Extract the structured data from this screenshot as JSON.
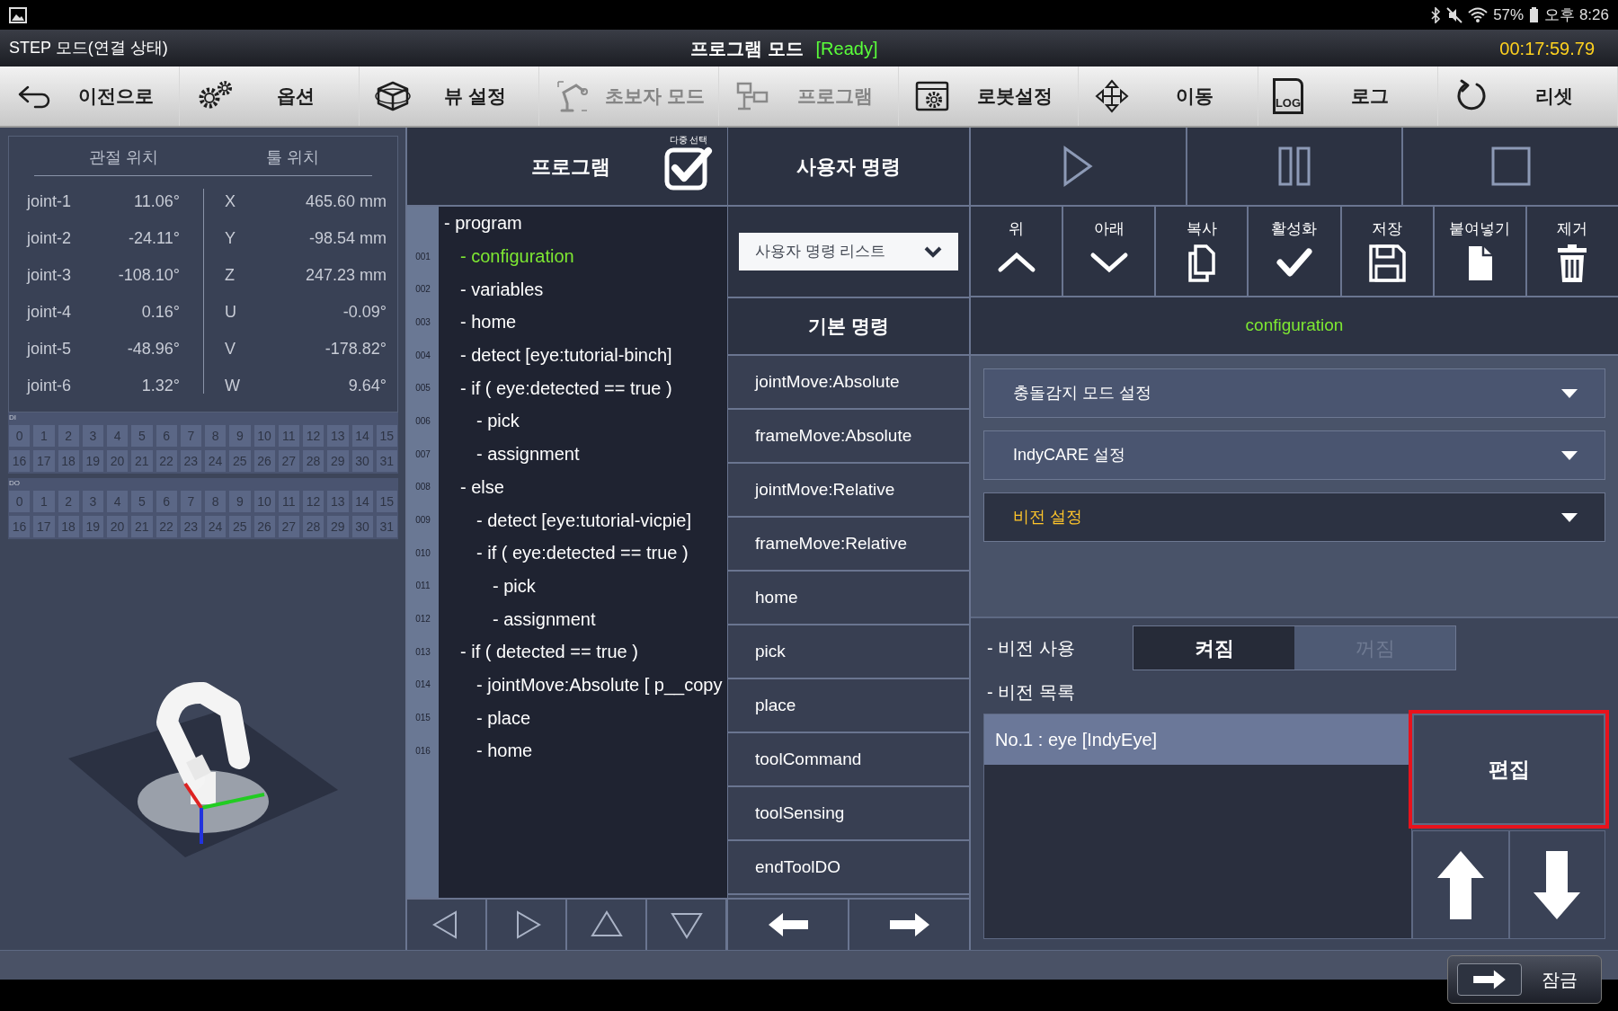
{
  "status_bar": {
    "battery": "57%",
    "time": "오후 8:26"
  },
  "title_bar": {
    "mode_label": "STEP 모드(연결 상태)",
    "title": "프로그램 모드",
    "state": "[Ready]",
    "timer": "00:17:59.79"
  },
  "toolbar": [
    {
      "label": "이전으로",
      "kind": "back",
      "disabled": false
    },
    {
      "label": "옵션",
      "kind": "gears",
      "disabled": false
    },
    {
      "label": "뷰 설정",
      "kind": "cube",
      "disabled": false
    },
    {
      "label": "초보자 모드",
      "kind": "arm",
      "disabled": true
    },
    {
      "label": "프로그램",
      "kind": "tree",
      "disabled": true
    },
    {
      "label": "로봇설정",
      "kind": "window",
      "disabled": false
    },
    {
      "label": "이동",
      "kind": "move",
      "disabled": false
    },
    {
      "label": "로그",
      "kind": "log",
      "icon_text": "LOG",
      "disabled": false
    },
    {
      "label": "리셋",
      "kind": "reset",
      "disabled": false
    }
  ],
  "position_panel": {
    "joint_heading": "관절 위치",
    "tool_heading": "툴 위치",
    "rows": [
      {
        "joint": "joint-1",
        "joint_value": "11.06°",
        "axis": "X",
        "tool_value": "465.60 mm"
      },
      {
        "joint": "joint-2",
        "joint_value": "-24.11°",
        "axis": "Y",
        "tool_value": "-98.54 mm"
      },
      {
        "joint": "joint-3",
        "joint_value": "-108.10°",
        "axis": "Z",
        "tool_value": "247.23 mm"
      },
      {
        "joint": "joint-4",
        "joint_value": "0.16°",
        "axis": "U",
        "tool_value": "-0.09°"
      },
      {
        "joint": "joint-5",
        "joint_value": "-48.96°",
        "axis": "V",
        "tool_value": "-178.82°"
      },
      {
        "joint": "joint-6",
        "joint_value": "1.32°",
        "axis": "W",
        "tool_value": "9.64°"
      }
    ]
  },
  "io": [
    {
      "label": "DI",
      "cells": [
        "0",
        "1",
        "2",
        "3",
        "4",
        "5",
        "6",
        "7",
        "8",
        "9",
        "10",
        "11",
        "12",
        "13",
        "14",
        "15",
        "16",
        "17",
        "18",
        "19",
        "20",
        "21",
        "22",
        "23",
        "24",
        "25",
        "26",
        "27",
        "28",
        "29",
        "30",
        "31"
      ]
    },
    {
      "label": "DO",
      "cells": [
        "0",
        "1",
        "2",
        "3",
        "4",
        "5",
        "6",
        "7",
        "8",
        "9",
        "10",
        "11",
        "12",
        "13",
        "14",
        "15",
        "16",
        "17",
        "18",
        "19",
        "20",
        "21",
        "22",
        "23",
        "24",
        "25",
        "26",
        "27",
        "28",
        "29",
        "30",
        "31"
      ]
    }
  ],
  "program": {
    "title": "프로그램",
    "multi_select_label": "다중 선택",
    "multi_select_checked": true,
    "tree": [
      {
        "text": "- program",
        "selected": false,
        "children": [
          {
            "line": "001",
            "text": "- configuration",
            "selected": true
          },
          {
            "line": "002",
            "text": "- variables",
            "selected": false
          },
          {
            "line": "003",
            "text": "- home",
            "selected": false
          },
          {
            "line": "004",
            "text": "- detect [eye:tutorial-binch]",
            "selected": false
          },
          {
            "line": "005",
            "text": "- if ( eye:detected == true )",
            "selected": false,
            "children": [
              {
                "line": "006",
                "text": "- pick",
                "selected": false
              },
              {
                "line": "007",
                "text": "- assignment",
                "selected": false
              }
            ]
          },
          {
            "line": "008",
            "text": "- else",
            "selected": false,
            "children": [
              {
                "line": "009",
                "text": "- detect [eye:tutorial-vicpie]",
                "selected": false
              },
              {
                "line": "010",
                "text": "- if ( eye:detected == true )",
                "selected": false,
                "children": [
                  {
                    "line": "011",
                    "text": "- pick",
                    "selected": false
                  },
                  {
                    "line": "012",
                    "text": "- assignment",
                    "selected": false
                  }
                ]
              }
            ]
          },
          {
            "line": "013",
            "text": "- if ( detected == true )",
            "selected": false,
            "children": [
              {
                "line": "014",
                "text": "- jointMove:Absolute [ p__copy",
                "selected": false
              },
              {
                "line": "015",
                "text": "- place",
                "selected": false
              },
              {
                "line": "016",
                "text": "- home",
                "selected": false
              }
            ]
          }
        ]
      }
    ]
  },
  "user_commands": {
    "title": "사용자 명령",
    "dropdown": "사용자 명령 리스트",
    "basic_title": "기본 명령",
    "commands": [
      "jointMove:Absolute",
      "frameMove:Absolute",
      "jointMove:Relative",
      "frameMove:Relative",
      "home",
      "pick",
      "place",
      "toolCommand",
      "toolSensing",
      "endToolDO"
    ]
  },
  "edit_actions": [
    {
      "label": "위",
      "kind": "up"
    },
    {
      "label": "아래",
      "kind": "down"
    },
    {
      "label": "복사",
      "kind": "copy"
    },
    {
      "label": "활성화",
      "kind": "check"
    },
    {
      "label": "저장",
      "kind": "save"
    },
    {
      "label": "붙여넣기",
      "kind": "paste"
    },
    {
      "label": "제거",
      "kind": "trash"
    }
  ],
  "selected_item": "configuration",
  "settings": [
    {
      "label": "충돌감지 모드 설정",
      "selected": false
    },
    {
      "label": "IndyCARE 설정",
      "selected": false
    },
    {
      "label": "비전 설정",
      "selected": true
    }
  ],
  "vision": {
    "use_label": "- 비전 사용",
    "options": [
      {
        "label": "켜짐",
        "selected": true
      },
      {
        "label": "꺼짐",
        "selected": false
      }
    ],
    "list_label": "- 비전 목록",
    "items": [
      {
        "text": "No.1 : eye [IndyEye]",
        "selected": true
      }
    ],
    "edit_button": {
      "label": "편집",
      "highlighted": true
    }
  },
  "lock_button": "잠금"
}
